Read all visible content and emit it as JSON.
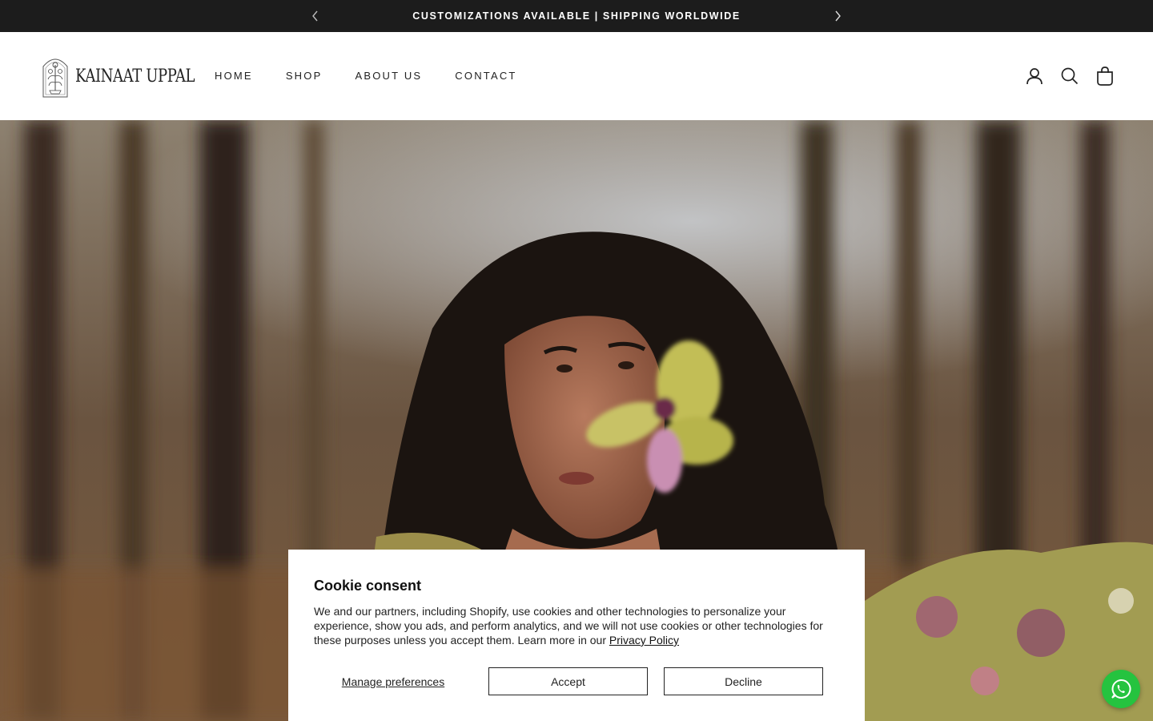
{
  "announcement": {
    "text": "CUSTOMIZATIONS AVAILABLE | SHIPPING WORLDWIDE",
    "prev_icon": "chevron-left-icon",
    "next_icon": "chevron-right-icon"
  },
  "header": {
    "logo_text": "KAINAAT UPPAL",
    "nav": [
      {
        "label": "HOME"
      },
      {
        "label": "SHOP"
      },
      {
        "label": "ABOUT US"
      },
      {
        "label": "CONTACT"
      }
    ],
    "icons": [
      "account-icon",
      "search-icon",
      "cart-bag-icon"
    ]
  },
  "hero": {
    "image": "portrait of woman with curly hair and orchid flower against forest background"
  },
  "cookie": {
    "title": "Cookie consent",
    "body": "We and our partners, including Shopify, use cookies and other technologies to personalize your experience, show you ads, and perform analytics, and we will not use cookies or other technologies for these purposes unless you accept them. Learn more in our ",
    "privacy_link": "Privacy Policy",
    "manage_label": "Manage preferences",
    "accept_label": "Accept",
    "decline_label": "Decline"
  },
  "colors": {
    "announcement_bg": "#1c1c1c",
    "whatsapp_green": "#25c33f"
  }
}
